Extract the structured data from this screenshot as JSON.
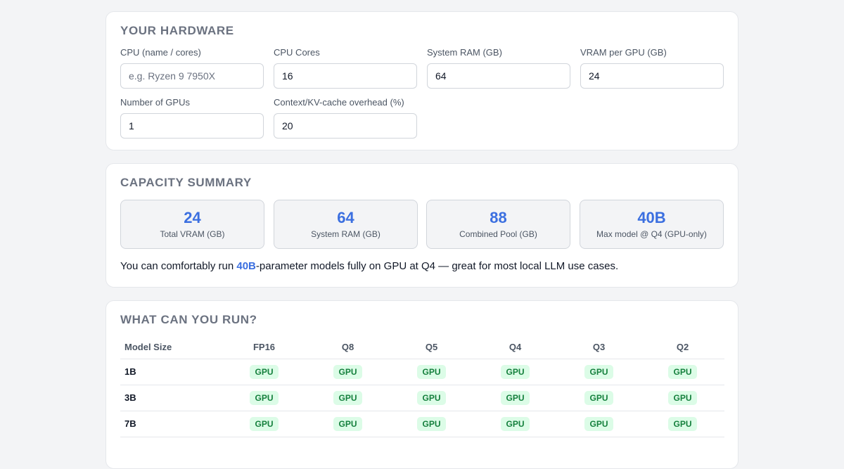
{
  "hardware": {
    "title": "YOUR HARDWARE",
    "fields": [
      {
        "label": "CPU (name / cores)",
        "value": "",
        "placeholder": "e.g. Ryzen 9 7950X"
      },
      {
        "label": "CPU Cores",
        "value": "16",
        "placeholder": ""
      },
      {
        "label": "System RAM (GB)",
        "value": "64",
        "placeholder": ""
      },
      {
        "label": "VRAM per GPU (GB)",
        "value": "24",
        "placeholder": ""
      },
      {
        "label": "Number of GPUs",
        "value": "1",
        "placeholder": ""
      },
      {
        "label": "Context/KV-cache overhead (%)",
        "value": "20",
        "placeholder": ""
      }
    ]
  },
  "summary": {
    "title": "CAPACITY SUMMARY",
    "stats": [
      {
        "value": "24",
        "label": "Total VRAM (GB)"
      },
      {
        "value": "64",
        "label": "System RAM (GB)"
      },
      {
        "value": "88",
        "label": "Combined Pool (GB)"
      },
      {
        "value": "40B",
        "label": "Max model @ Q4 (GPU-only)"
      }
    ],
    "line_prefix": "You can comfortably run ",
    "line_highlight": "40B",
    "line_suffix": "-parameter models fully on GPU at Q4 — great for most local LLM use cases."
  },
  "run": {
    "title": "WHAT CAN YOU RUN?",
    "headers": [
      "Model Size",
      "FP16",
      "Q8",
      "Q5",
      "Q4",
      "Q3",
      "Q2"
    ],
    "rows": [
      {
        "size": "1B",
        "cells": [
          "GPU",
          "GPU",
          "GPU",
          "GPU",
          "GPU",
          "GPU"
        ]
      },
      {
        "size": "3B",
        "cells": [
          "GPU",
          "GPU",
          "GPU",
          "GPU",
          "GPU",
          "GPU"
        ]
      },
      {
        "size": "7B",
        "cells": [
          "GPU",
          "GPU",
          "GPU",
          "GPU",
          "GPU",
          "GPU"
        ]
      }
    ]
  },
  "colors": {
    "accent": "#3b6fe0",
    "gpu_badge_bg": "#dcfce7",
    "gpu_badge_text": "#15803d"
  }
}
